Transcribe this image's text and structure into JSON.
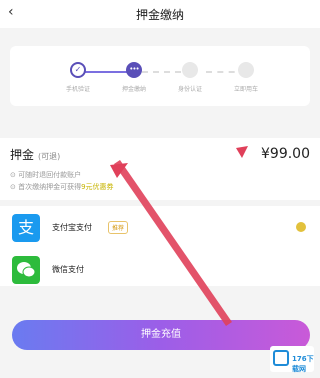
{
  "header": {
    "back_icon": "‹",
    "title": "押金缴纳"
  },
  "steps": [
    {
      "label": "手机验证",
      "state": "done"
    },
    {
      "label": "押金缴纳",
      "state": "active"
    },
    {
      "label": "身份认证",
      "state": "pending"
    },
    {
      "label": "立即用车",
      "state": "pending"
    }
  ],
  "deposit": {
    "title": "押金",
    "subtitle": "(可退)",
    "amount": "¥99.00",
    "notes": [
      {
        "text": "可随时退回付款账户",
        "highlight": ""
      },
      {
        "text": "首次缴纳押金可获得",
        "highlight": "9元优惠券"
      }
    ]
  },
  "payment_methods": [
    {
      "name": "支付宝支付",
      "tag": "推荐",
      "icon": "alipay-icon",
      "icon_glyph": "支",
      "selected": true
    },
    {
      "name": "微信支付",
      "tag": "",
      "icon": "wechat-icon",
      "icon_glyph": "",
      "selected": false
    }
  ],
  "submit": {
    "label": "押金充值"
  },
  "watermark": {
    "text": "176下载网"
  },
  "colors": {
    "accent": "#5a4fb8",
    "alipay": "#1a9aef",
    "wechat": "#2dbb3c",
    "arrow": "#e0405a"
  }
}
